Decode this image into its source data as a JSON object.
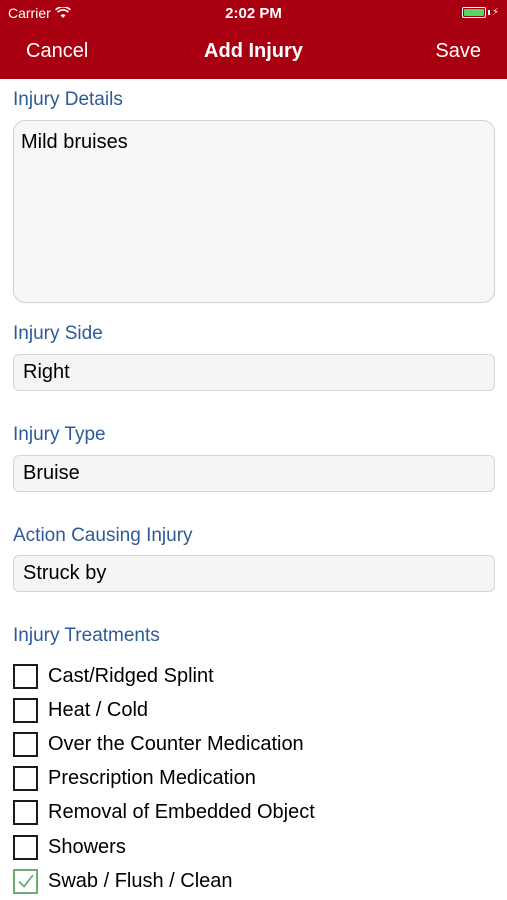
{
  "status_bar": {
    "carrier": "Carrier",
    "time": "2:02 PM",
    "battery_color": "#4cd964"
  },
  "nav": {
    "cancel_label": "Cancel",
    "title": "Add Injury",
    "save_label": "Save",
    "bar_color": "#a80010"
  },
  "form": {
    "injury_details": {
      "label": "Injury Details",
      "value": "Mild bruises"
    },
    "injury_side": {
      "label": "Injury Side",
      "value": "Right"
    },
    "injury_type": {
      "label": "Injury Type",
      "value": "Bruise"
    },
    "action_causing_injury": {
      "label": "Action Causing Injury",
      "value": "Struck by"
    },
    "treatments": {
      "label": "Injury Treatments",
      "items": [
        {
          "label": "Cast/Ridged Splint",
          "checked": false
        },
        {
          "label": "Heat / Cold",
          "checked": false
        },
        {
          "label": "Over the Counter Medication",
          "checked": false
        },
        {
          "label": "Prescription Medication",
          "checked": false
        },
        {
          "label": "Removal of Embedded Object",
          "checked": false
        },
        {
          "label": "Showers",
          "checked": false
        },
        {
          "label": "Swab / Flush / Clean",
          "checked": true
        }
      ]
    }
  },
  "colors": {
    "section_label": "#2e5b96",
    "checked_box": "#6cae6a"
  }
}
